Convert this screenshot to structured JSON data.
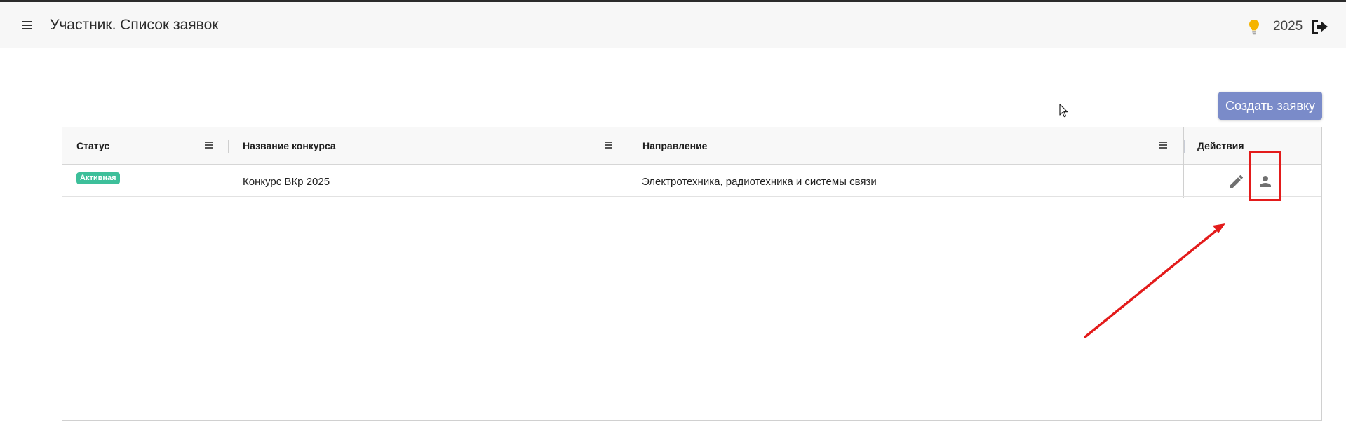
{
  "app_bar": {
    "title": "Участник. Список заявок",
    "year": "2025",
    "icons": {
      "menu": "hamburger-menu-icon",
      "theme": "lightbulb-icon",
      "logout": "logout-icon"
    }
  },
  "toolbar": {
    "create_label": "Создать заявку"
  },
  "table": {
    "columns": [
      {
        "key": "status",
        "label": "Статус"
      },
      {
        "key": "contest",
        "label": "Название конкурса"
      },
      {
        "key": "direction",
        "label": "Направление"
      },
      {
        "key": "actions",
        "label": "Действия"
      }
    ],
    "rows": [
      {
        "status": "Активная",
        "contest": "Конкурс ВКр 2025",
        "direction": "Электротехника, радиотехника и системы связи",
        "actions": [
          "pencil-icon",
          "person-icon"
        ]
      }
    ]
  },
  "colors": {
    "accent_button": "#7a8bc9",
    "status_active": "#3dbf9a",
    "annotation": "#e31b1b",
    "app_bar_bg": "#f7f7f7"
  }
}
